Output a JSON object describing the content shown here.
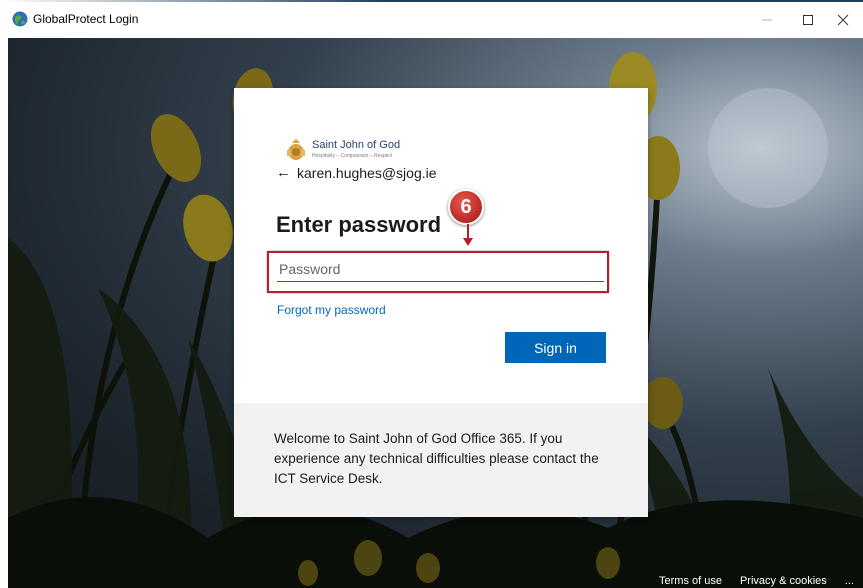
{
  "window": {
    "title": "GlobalProtect Login",
    "minimize_label": "—",
    "maximize_label": "☐",
    "close_label": "✕"
  },
  "brand": {
    "name": "Saint John of God",
    "tagline": "Hospitality – Compassion – Respect",
    "accent_color": "#2b3f73"
  },
  "login": {
    "back_icon": "←",
    "account": "karen.hughes@sjog.ie",
    "heading": "Enter password",
    "password_placeholder": "Password",
    "password_value": "",
    "forgot_link": "Forgot my password",
    "signin_label": "Sign in",
    "signin_color": "#0067b8"
  },
  "notice": {
    "text": "Welcome to Saint John of God Office 365. If you experience any technical difficulties please contact the ICT Service Desk."
  },
  "annotation": {
    "step_number": "6",
    "highlight_color": "#b51e2a"
  },
  "footer": {
    "terms": "Terms of use",
    "privacy": "Privacy & cookies",
    "more": "..."
  }
}
